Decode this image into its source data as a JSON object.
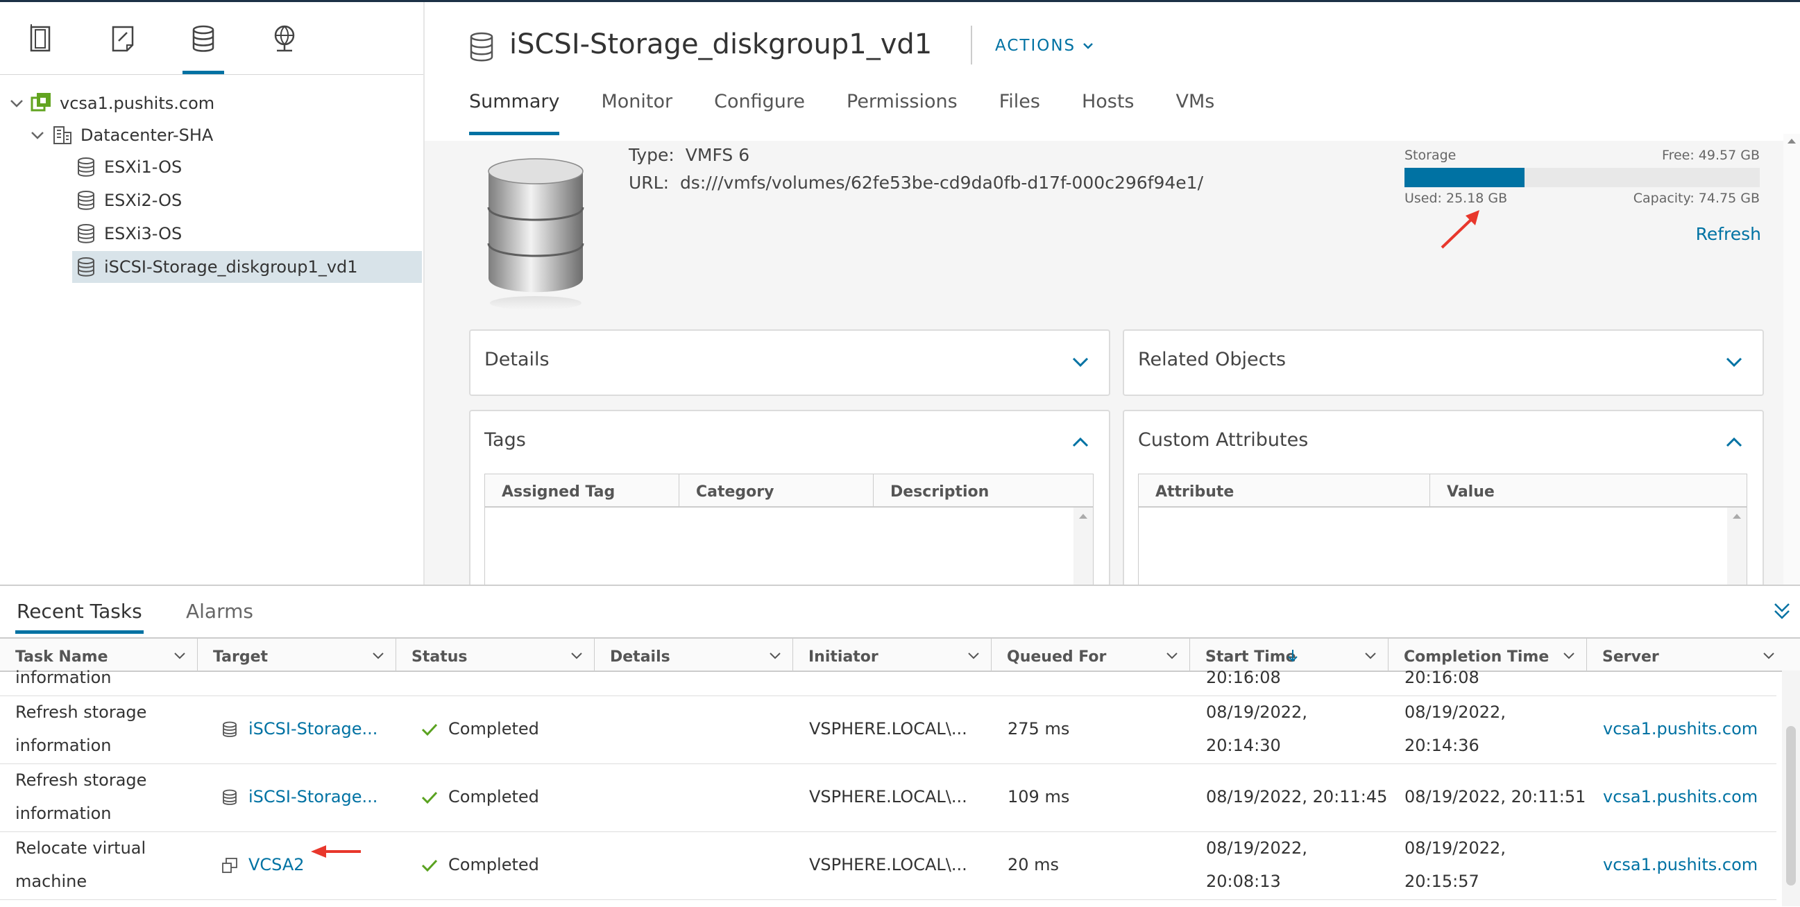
{
  "navigator": {
    "tabs": [
      "hosts-and-clusters-icon",
      "vms-and-templates-icon",
      "storage-icon",
      "networking-icon"
    ],
    "tree": [
      {
        "label": "vcsa1.pushits.com",
        "icon": "vcenter-icon"
      },
      {
        "label": "Datacenter-SHA",
        "icon": "datacenter-icon"
      },
      {
        "label": "ESXi1-OS",
        "icon": "datastore-icon"
      },
      {
        "label": "ESXi2-OS",
        "icon": "datastore-icon"
      },
      {
        "label": "ESXi3-OS",
        "icon": "datastore-icon"
      },
      {
        "label": "iSCSI-Storage_diskgroup1_vd1",
        "icon": "datastore-icon",
        "selected": true
      }
    ]
  },
  "header": {
    "title": "iSCSI-Storage_diskgroup1_vd1",
    "actions_label": "ACTIONS",
    "tabs": [
      "Summary",
      "Monitor",
      "Configure",
      "Permissions",
      "Files",
      "Hosts",
      "VMs"
    ],
    "active_tab": "Summary"
  },
  "summary": {
    "type_label": "Type:",
    "type_value": "VMFS 6",
    "url_label": "URL:",
    "url_value": "ds:///vmfs/volumes/62fe53be-cd9da0fb-d17f-000c296f94e1/",
    "storage": {
      "title": "Storage",
      "free": "Free: 49.57 GB",
      "used": "Used: 25.18 GB",
      "capacity": "Capacity: 74.75 GB",
      "used_fraction": 0.337,
      "refresh_label": "Refresh"
    }
  },
  "cards": {
    "details": {
      "title": "Details"
    },
    "related": {
      "title": "Related Objects"
    },
    "tags": {
      "title": "Tags",
      "columns": [
        "Assigned Tag",
        "Category",
        "Description"
      ]
    },
    "custom": {
      "title": "Custom Attributes",
      "columns": [
        "Attribute",
        "Value"
      ]
    }
  },
  "bottom": {
    "tabs": [
      "Recent Tasks",
      "Alarms"
    ],
    "columns": [
      "Task Name",
      "Target",
      "Status",
      "Details",
      "Initiator",
      "Queued For",
      "Start Time",
      "Completion Time",
      "Server"
    ],
    "partial_row": {
      "task": "information",
      "start": "20:16:08",
      "completion": "20:16:08"
    },
    "rows": [
      {
        "task_line1": "Refresh storage",
        "task_line2": "information",
        "target": "iSCSI-Storage...",
        "target_icon": "datastore-icon",
        "status": "Completed",
        "initiator": "VSPHERE.LOCAL\\...",
        "queued": "275 ms",
        "start_line1": "08/19/2022,",
        "start_line2": "20:14:30",
        "completion_line1": "08/19/2022,",
        "completion_line2": "20:14:36",
        "server": "vcsa1.pushits.com"
      },
      {
        "task_line1": "Refresh storage",
        "task_line2": "information",
        "target": "iSCSI-Storage...",
        "target_icon": "datastore-icon",
        "status": "Completed",
        "initiator": "VSPHERE.LOCAL\\...",
        "queued": "109 ms",
        "start_line1": "08/19/2022, 20:11:45",
        "start_line2": "",
        "completion_line1": "08/19/2022, 20:11:51",
        "completion_line2": "",
        "server": "vcsa1.pushits.com"
      },
      {
        "task_line1": "Relocate virtual",
        "task_line2": "machine",
        "target": "VCSA2",
        "target_icon": "vm-icon",
        "status": "Completed",
        "initiator": "VSPHERE.LOCAL\\...",
        "queued": "20 ms",
        "start_line1": "08/19/2022,",
        "start_line2": "20:08:13",
        "completion_line1": "08/19/2022,",
        "completion_line2": "20:15:57",
        "server": "vcsa1.pushits.com"
      }
    ]
  },
  "colors": {
    "accent": "#0072a3",
    "success": "#5aa220",
    "annotation": "#e8372c"
  }
}
